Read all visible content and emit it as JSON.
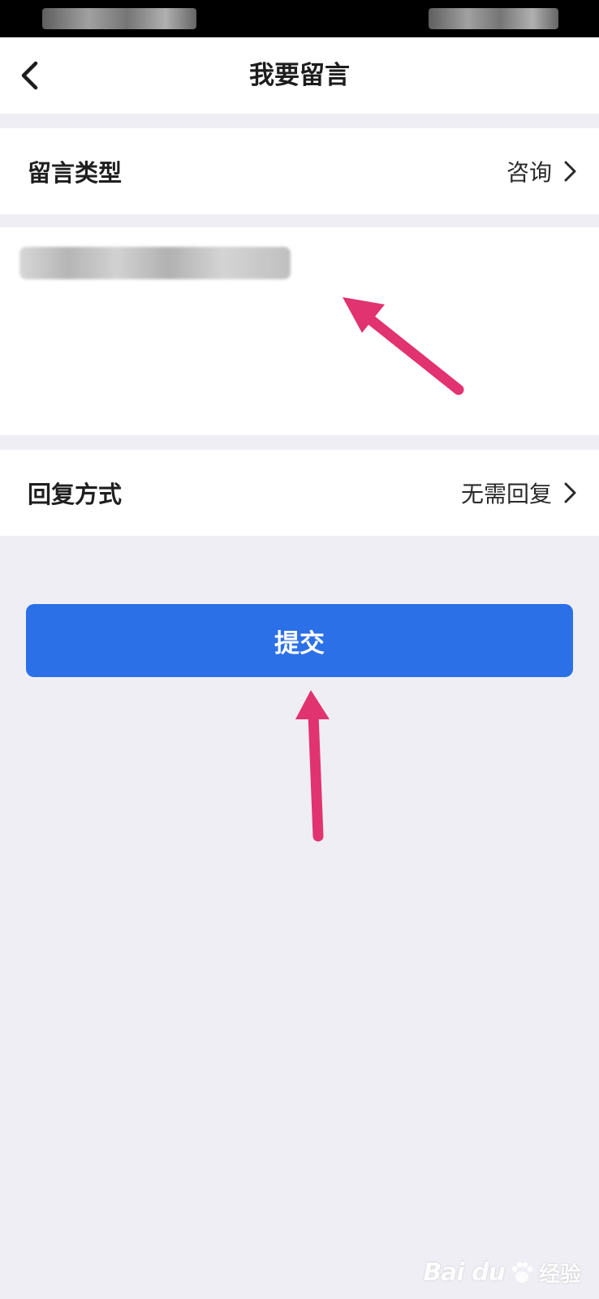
{
  "nav": {
    "title": "我要留言"
  },
  "form": {
    "type_row": {
      "label": "留言类型",
      "value": "咨询"
    },
    "reply_row": {
      "label": "回复方式",
      "value": "无需回复"
    },
    "submit_label": "提交"
  },
  "watermark": {
    "logo": "Bai du",
    "text": "经验"
  },
  "icons": {
    "back": "chevron-left-icon",
    "chevron": "chevron-right-icon",
    "annotation": "pink-arrow"
  },
  "colors": {
    "accent": "#2c70e8",
    "arrow": "#e0336f",
    "background": "#efeef4"
  }
}
